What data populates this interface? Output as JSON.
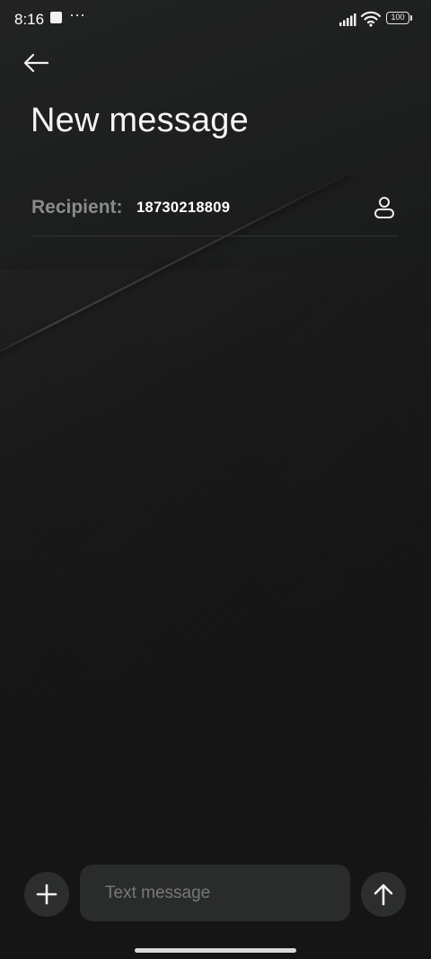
{
  "status_bar": {
    "time": "8:16",
    "notification_more": "···",
    "battery_level": "100",
    "icons": [
      "notification-square-icon",
      "signal-icon",
      "wifi-icon",
      "battery-icon"
    ]
  },
  "header": {
    "back_icon": "arrow-left-icon",
    "title": "New message"
  },
  "recipient": {
    "label": "Recipient:",
    "value": "18730218809",
    "contact_icon": "person-icon"
  },
  "compose": {
    "add_icon": "plus-icon",
    "placeholder": "Text message",
    "value": "",
    "send_icon": "arrow-up-icon"
  },
  "colors": {
    "background": "#1b1c1c",
    "text_primary": "#ffffff",
    "label_gray": "#8a8c8c",
    "button_bg": "#2c2d2d"
  }
}
